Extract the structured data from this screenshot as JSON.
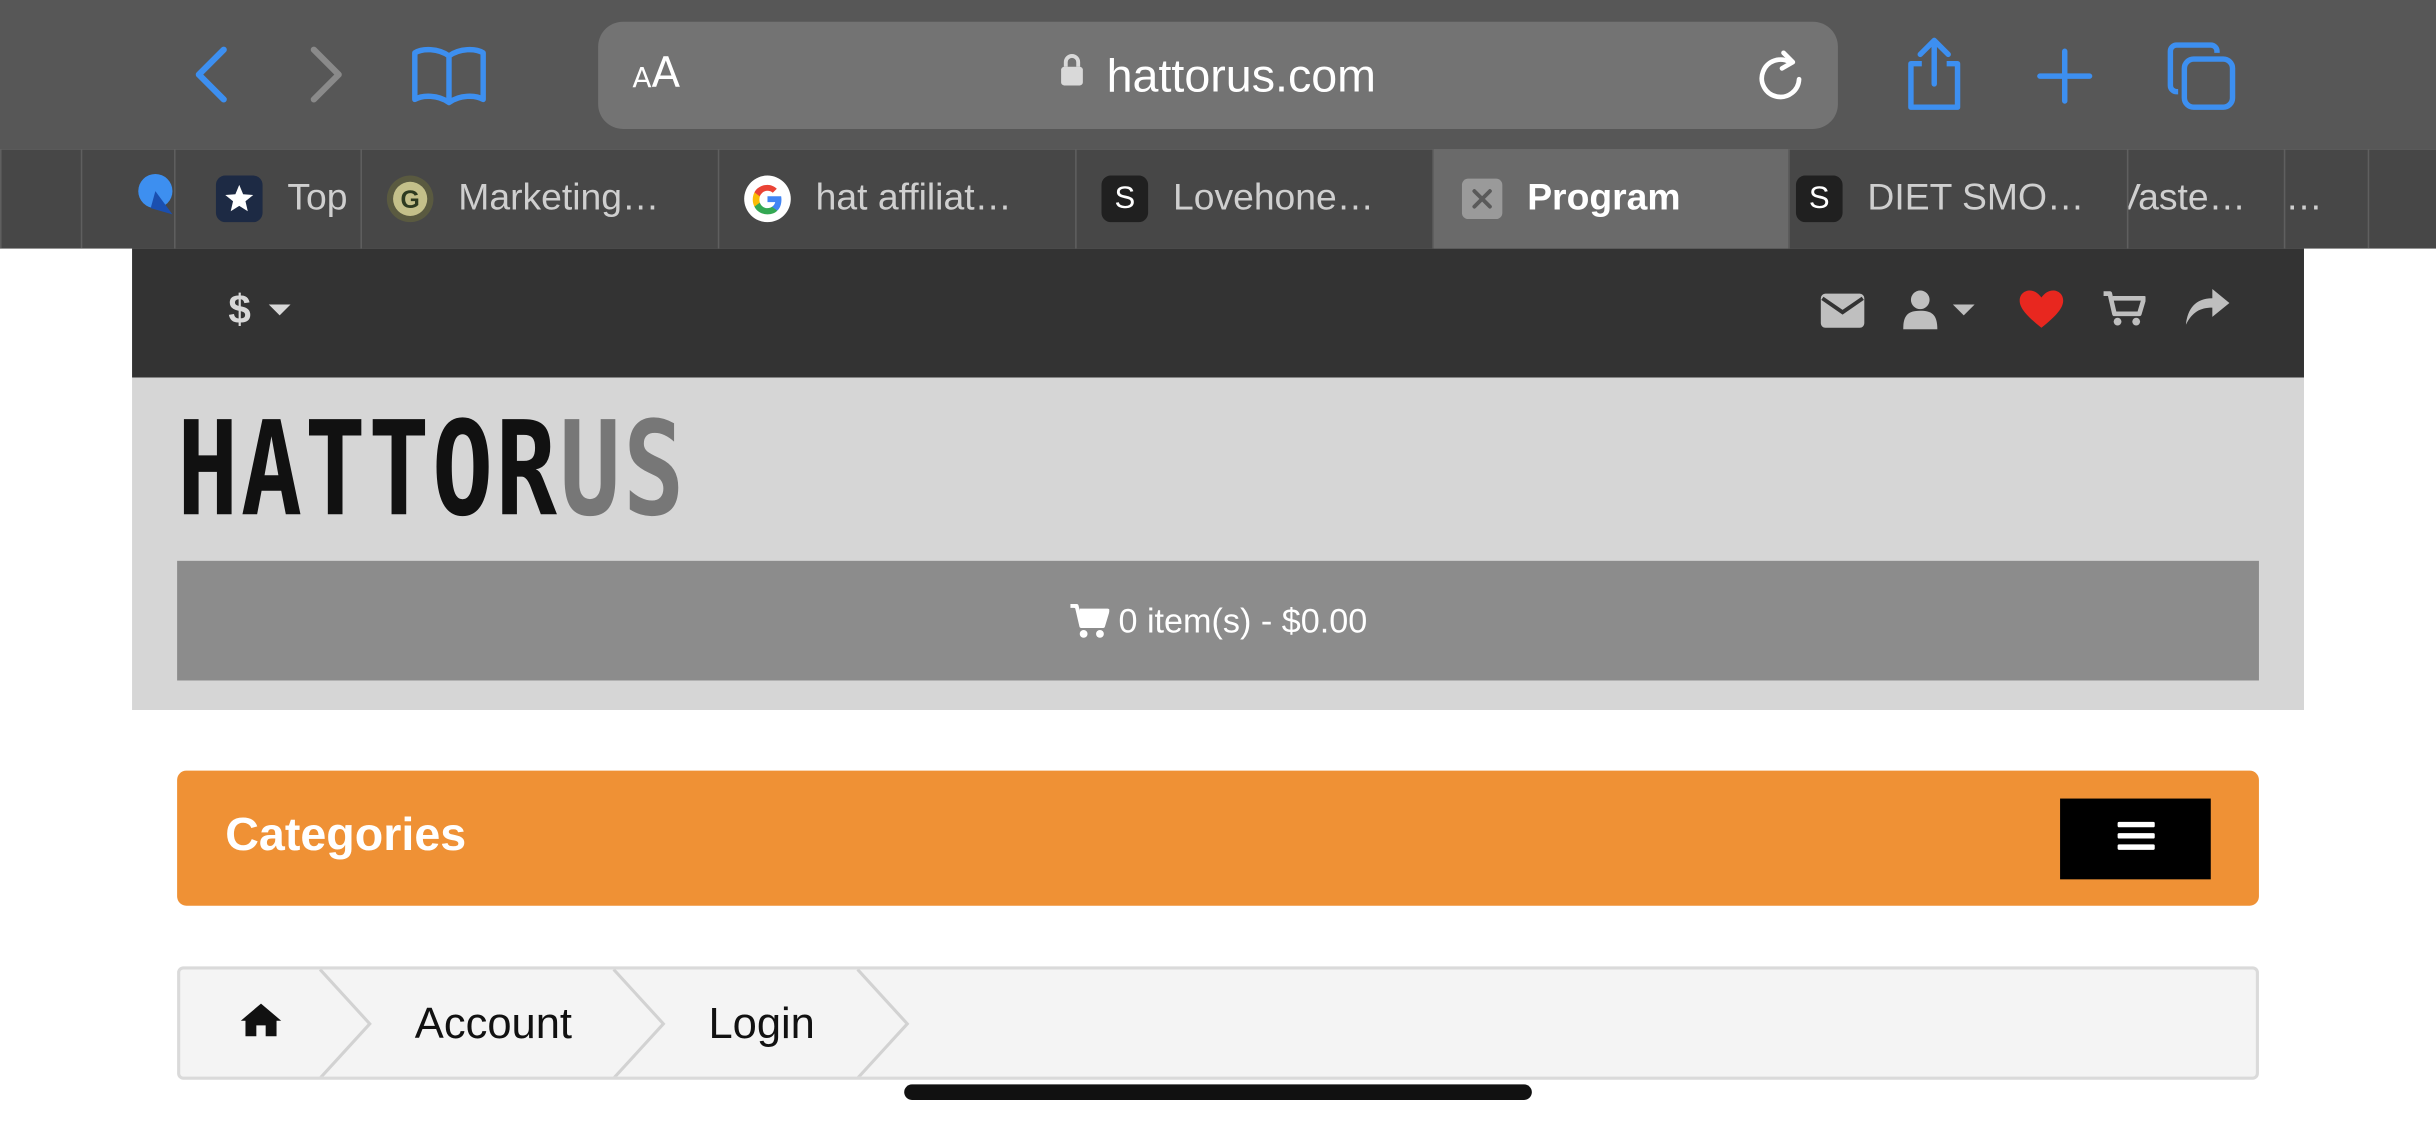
{
  "browser": {
    "url": "hattorus.com",
    "text_size_small": "A",
    "text_size_large": "A",
    "accent_color": "#3d8ff0",
    "icons": [
      "back-icon",
      "forward-icon",
      "bookmarks-icon",
      "lock-icon",
      "reload-icon",
      "share-icon",
      "new-tab-icon",
      "tabs-overview-icon"
    ]
  },
  "tabs": [
    {
      "label": "",
      "favicon": "blue-bubble-icon"
    },
    {
      "label": "Top",
      "favicon": "star-badge-icon"
    },
    {
      "label": "Marketing…",
      "favicon": "g-logo-icon"
    },
    {
      "label": "hat affiliat…",
      "favicon": "google-icon"
    },
    {
      "label": "Lovehone…",
      "favicon": "S"
    },
    {
      "label": "Program",
      "favicon": "close-icon",
      "active": true
    },
    {
      "label": "DIET SMO…",
      "favicon": "S"
    },
    {
      "label": "Vaste…",
      "favicon": ""
    },
    {
      "label": "…",
      "favicon": ""
    }
  ],
  "site": {
    "currency": "$",
    "top_icons": [
      "mail-icon",
      "user-icon",
      "heart-icon",
      "cart-icon",
      "share-arrow-icon"
    ],
    "heart_color": "#e8271f",
    "logo": {
      "dark": "HATTOR",
      "grey": "US"
    },
    "cart_summary": "0 item(s) - $0.00",
    "categories_label": "Categories",
    "categories_color": "#ef9135",
    "breadcrumb": {
      "items": [
        "Account",
        "Login"
      ]
    }
  }
}
